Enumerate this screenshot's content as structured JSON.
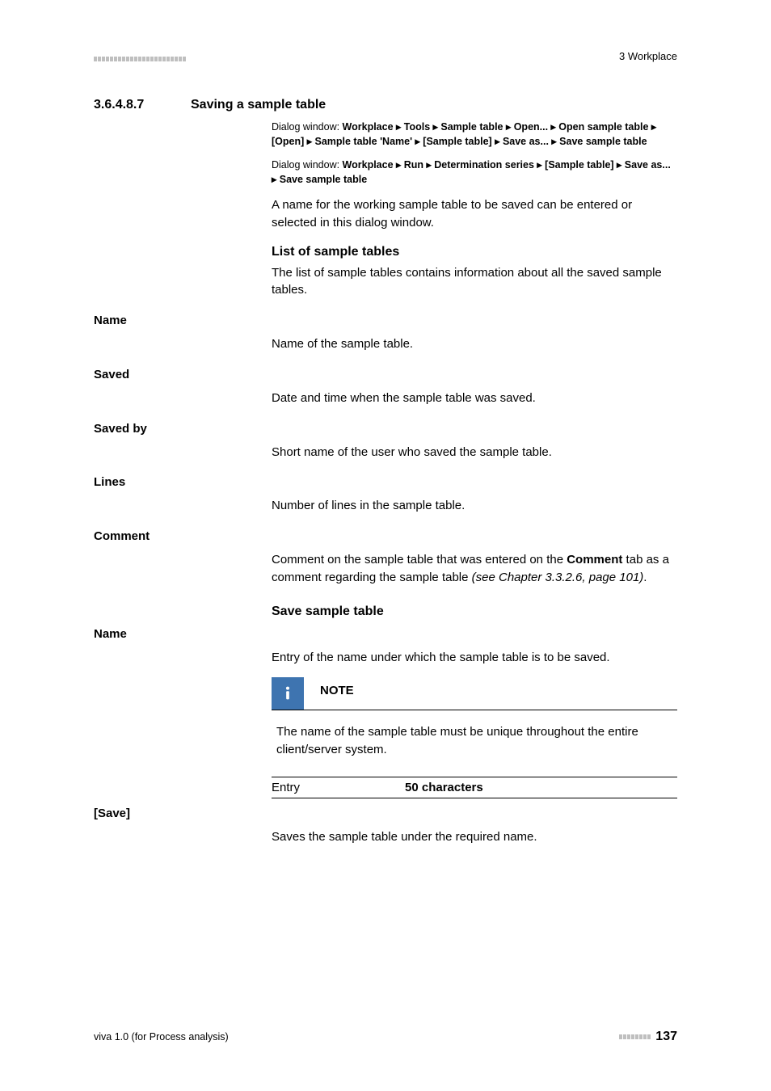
{
  "header": {
    "right": "3 Workplace"
  },
  "section": {
    "number": "3.6.4.8.7",
    "title": "Saving a sample table"
  },
  "dialog1": {
    "lead": "Dialog window: ",
    "path": "Workplace ▸ Tools ▸ Sample table ▸ Open... ▸ Open sample table ▸ [Open] ▸ Sample table 'Name' ▸ [Sample table] ▸ Save as... ▸ Save sample table"
  },
  "dialog2": {
    "lead": "Dialog window: ",
    "path": "Workplace ▸ Run ▸ Determination series ▸ [Sample table] ▸ Save as... ▸ Save sample table"
  },
  "intro": "A name for the working sample table to be saved can be entered or selected in this dialog window.",
  "sub1": {
    "title": "List of sample tables",
    "desc": "The list of sample tables contains information about all the saved sample tables."
  },
  "fields": [
    {
      "label": "Name",
      "desc": "Name of the sample table."
    },
    {
      "label": "Saved",
      "desc": "Date and time when the sample table was saved."
    },
    {
      "label": "Saved by",
      "desc": "Short name of the user who saved the sample table."
    },
    {
      "label": "Lines",
      "desc": "Number of lines in the sample table."
    }
  ],
  "comment": {
    "label": "Comment",
    "pre": "Comment on the sample table that was entered on the ",
    "bold": "Comment",
    "post": " tab as a comment regarding the sample table ",
    "italic": "(see Chapter 3.3.2.6, page 101)",
    "end": "."
  },
  "sub2": {
    "title": "Save sample table"
  },
  "save_name": {
    "label": "Name",
    "desc": "Entry of the name under which the sample table is to be saved."
  },
  "note": {
    "label": "NOTE",
    "text": "The name of the sample table must be unique throughout the entire client/server system."
  },
  "entry": {
    "left": "Entry",
    "right": "50 characters"
  },
  "save": {
    "label": "[Save]",
    "desc": "Saves the sample table under the required name."
  },
  "footer": {
    "left": "viva 1.0 (for Process analysis)",
    "page": "137"
  }
}
